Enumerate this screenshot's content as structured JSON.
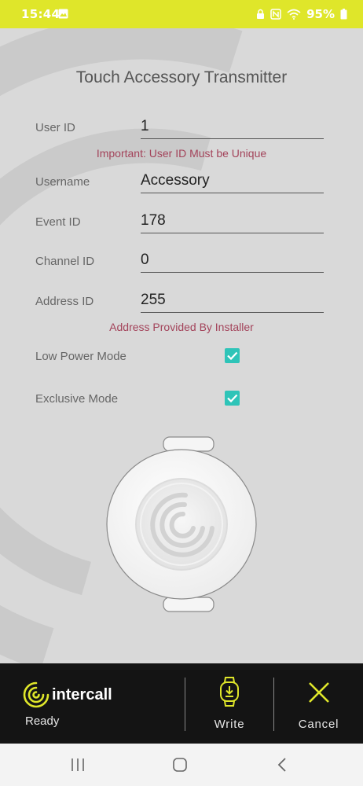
{
  "status_bar": {
    "time": "15:44",
    "battery": "95%",
    "icons": [
      "gallery-icon",
      "lock-icon",
      "nfc-icon",
      "wifi-icon",
      "battery-icon"
    ],
    "color": "#dfe62a"
  },
  "title": "Touch Accessory Transmitter",
  "form": {
    "user_id": {
      "label": "User ID",
      "value": "1"
    },
    "user_id_note": "Important: User ID Must be Unique",
    "username": {
      "label": "Username",
      "value": "Accessory"
    },
    "event_id": {
      "label": "Event ID",
      "value": "178"
    },
    "channel_id": {
      "label": "Channel ID",
      "value": "0"
    },
    "address_id": {
      "label": "Address ID",
      "value": "255"
    },
    "address_note": "Address Provided By Installer",
    "low_power_mode": {
      "label": "Low Power Mode",
      "checked": true
    },
    "exclusive_mode": {
      "label": "Exclusive Mode",
      "checked": true
    }
  },
  "bottom_bar": {
    "logo_text": "intercall",
    "status": "Ready",
    "write_label": "Write",
    "cancel_label": "Cancel",
    "accent_color": "#dfe62a"
  },
  "nav_bar": {
    "icons": [
      "recents-icon",
      "home-icon",
      "back-icon"
    ]
  },
  "colors": {
    "note_text": "#a3435a",
    "checkbox": "#2ec4b8"
  }
}
